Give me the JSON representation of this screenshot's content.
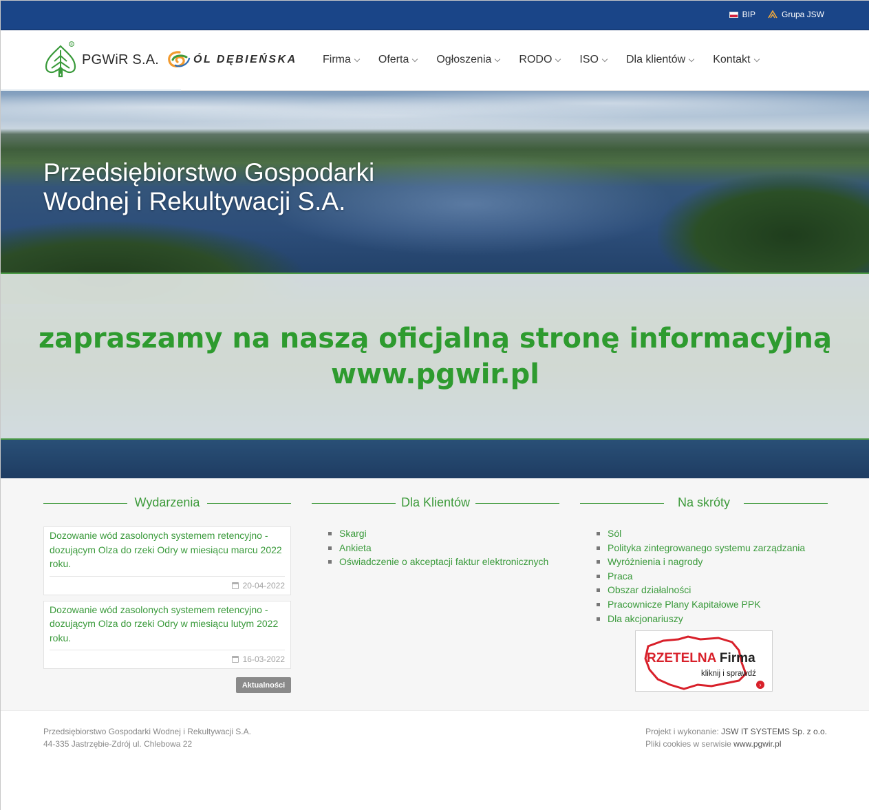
{
  "topbar": {
    "links": [
      {
        "label": "BIP",
        "icon": "flag-icon"
      },
      {
        "label": "Grupa JSW",
        "icon": "jsw-icon"
      }
    ],
    "background": "#1a4588"
  },
  "header": {
    "logo_text": "PGWiR S.A.",
    "logo_registered": "®",
    "sol_logo_text": "ÓL DĘBIEŃSKA",
    "nav": [
      "Firma",
      "Oferta",
      "Ogłoszenia",
      "RODO",
      "ISO",
      "Dla klientów",
      "Kontakt"
    ]
  },
  "hero": {
    "title_line1": "Przedsiębiorstwo Gospodarki",
    "title_line2": "Wodnej i Rekultywacji S.A.",
    "band_line1": "zapraszamy na naszą oficjalną stronę informacyjną",
    "band_line2": "www.pgwir.pl",
    "accent": "#2e9b2f"
  },
  "events": {
    "heading": "Wydarzenia",
    "items": [
      {
        "title": "Dozowanie wód zasolonych systemem retencyjno - dozującym Olza do rzeki Odry w miesiącu marcu 2022 roku.",
        "date": "20-04-2022"
      },
      {
        "title": "Dozowanie wód zasolonych systemem retencyjno - dozującym Olza do rzeki Odry w miesiącu lutym 2022 roku.",
        "date": "16-03-2022"
      }
    ],
    "more_button": "Aktualności"
  },
  "clients": {
    "heading": "Dla Klientów",
    "items": [
      "Skargi",
      "Ankieta",
      "Oświadczenie o akceptacji faktur elektronicznych"
    ]
  },
  "shortcuts": {
    "heading": "Na skróty",
    "items": [
      "Sól",
      "Polityka zintegrowanego systemu zarządzania",
      "Wyróżnienia i nagrody",
      "Praca",
      "Obszar działalności",
      "Pracownicze Plany Kapitałowe PPK",
      "Dla akcjonariuszy"
    ],
    "badge_title_red": "RZETELNA",
    "badge_title_dark": "Firma",
    "badge_sub": "kliknij i sprawdź"
  },
  "footer": {
    "left_line1": "Przedsiębiorstwo Gospodarki Wodnej i Rekultywacji S.A.",
    "left_line2": "44-335 Jastrzębie-Zdrój ul. Chlebowa 22",
    "right_label": "Projekt i wykonanie: ",
    "right_company": "JSW IT SYSTEMS Sp. z o.o.",
    "right_line2_label": "Pliki cookies w serwisie ",
    "right_line2_site": "www.pgwir.pl"
  }
}
